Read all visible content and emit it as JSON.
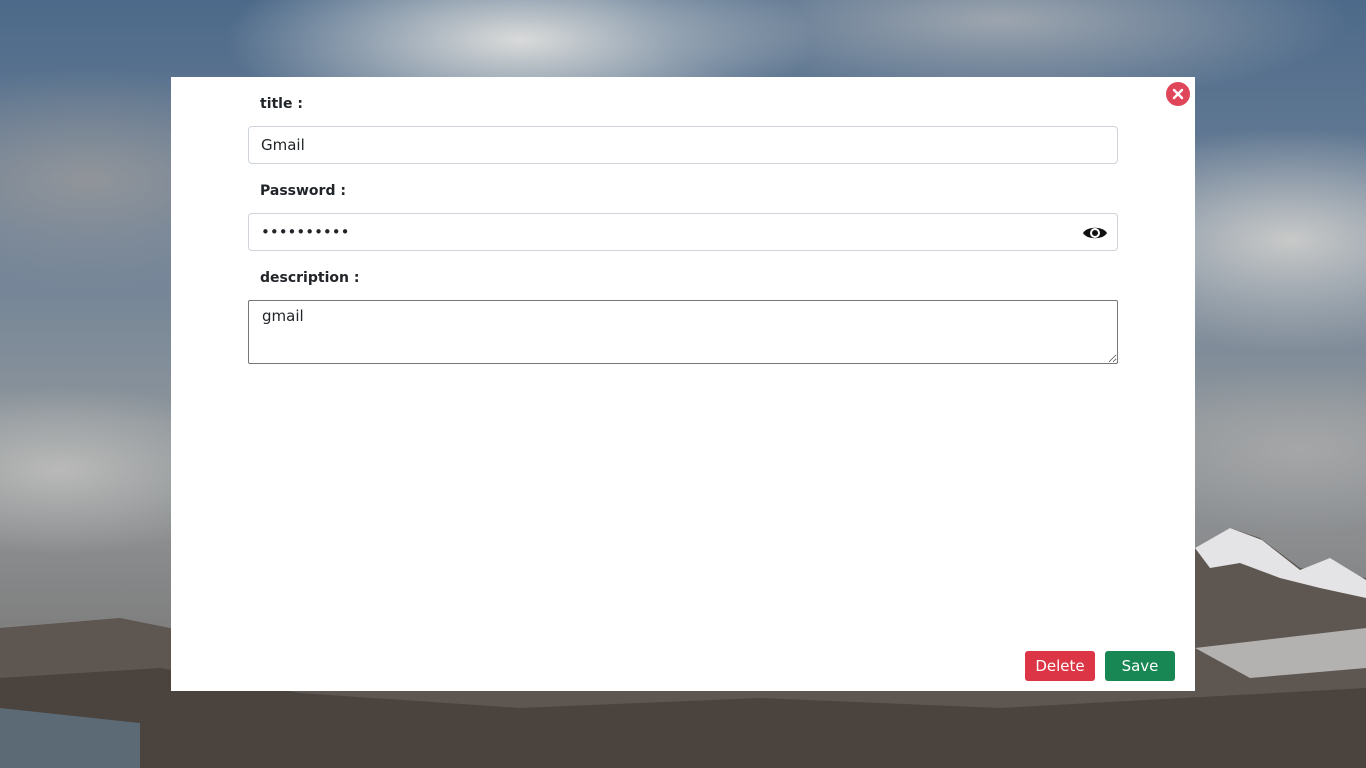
{
  "form": {
    "title_label": "title :",
    "title_value": "Gmail",
    "password_label": "Password :",
    "password_value": "••••••••••",
    "description_label": "description :",
    "description_value": "gmail"
  },
  "actions": {
    "delete_label": "Delete",
    "save_label": "Save"
  },
  "icons": {
    "close": "close-icon",
    "show_password": "eye-icon"
  },
  "colors": {
    "close": "#e0465a",
    "delete": "#dc3545",
    "save": "#198754"
  }
}
